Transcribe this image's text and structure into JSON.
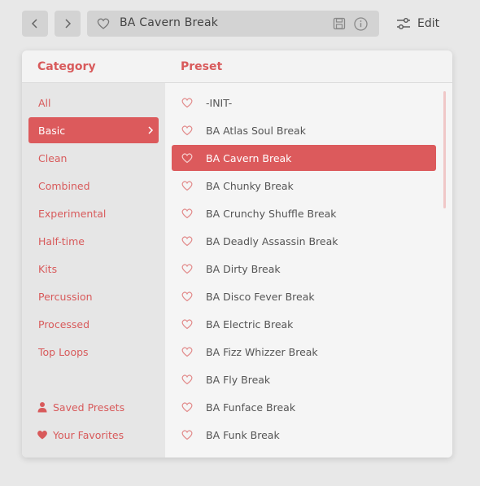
{
  "toolbar": {
    "back_icon": "chevron-left-icon",
    "forward_icon": "chevron-right-icon",
    "current_preset": "BA Cavern Break",
    "edit_label": "Edit"
  },
  "browser": {
    "category_header": "Category",
    "preset_header": "Preset",
    "categories": [
      "All",
      "Basic",
      "Clean",
      "Combined",
      "Experimental",
      "Half-time",
      "Kits",
      "Percussion",
      "Processed",
      "Top Loops"
    ],
    "selected_category": "Basic",
    "saved_presets_label": "Saved Presets",
    "favorites_label": "Your Favorites",
    "presets": [
      "-INIT-",
      "BA Atlas Soul Break",
      "BA Cavern Break",
      "BA Chunky Break",
      "BA Crunchy Shuffle Break",
      "BA Deadly Assassin Break",
      "BA Dirty Break",
      "BA Disco Fever Break",
      "BA Electric Break",
      "BA Fizz Whizzer Break",
      "BA Fly Break",
      "BA Funface Break",
      "BA Funk Break"
    ],
    "selected_preset": "BA Cavern Break"
  },
  "colors": {
    "accent": "#dc5a5c",
    "accent_text": "#d85a5b",
    "background": "#e8e8e8"
  }
}
